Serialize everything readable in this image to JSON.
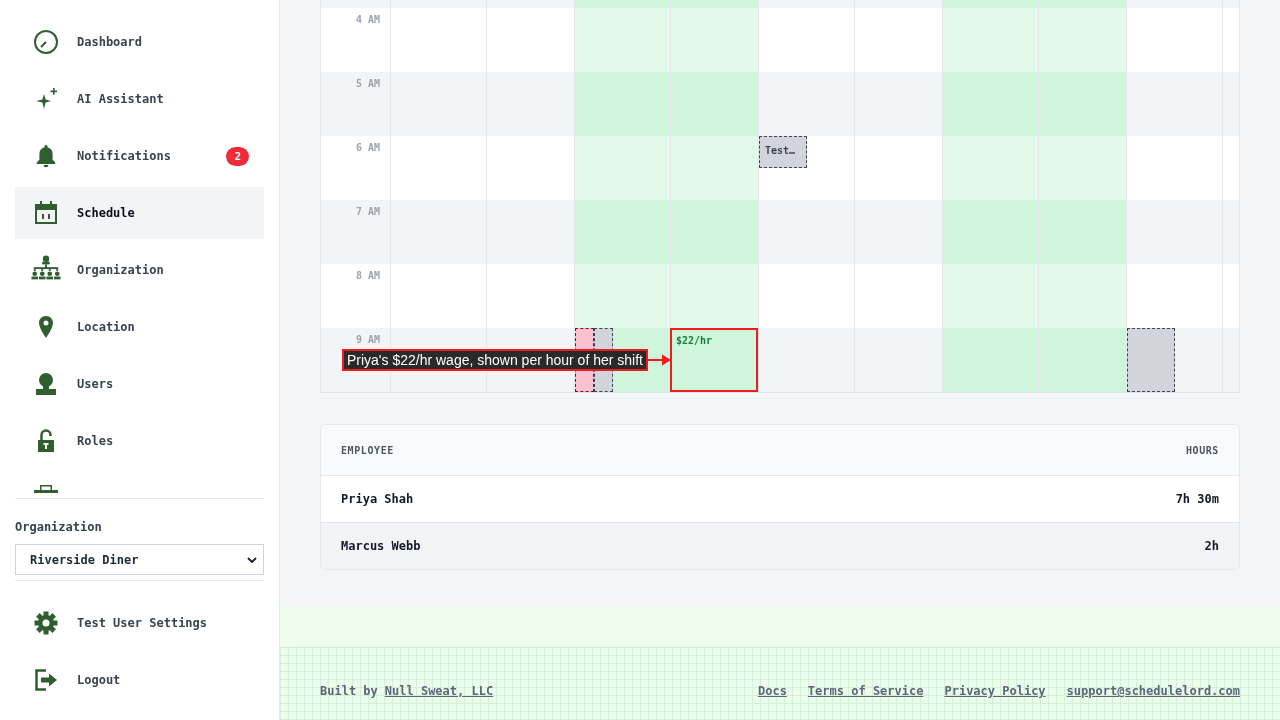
{
  "sidebar": {
    "nav": [
      {
        "label": "Dashboard",
        "selected": false
      },
      {
        "label": "AI Assistant",
        "selected": false
      },
      {
        "label": "Notifications",
        "selected": false,
        "badge": "2"
      },
      {
        "label": "Schedule",
        "selected": true
      },
      {
        "label": "Organization",
        "selected": false
      },
      {
        "label": "Location",
        "selected": false
      },
      {
        "label": "Users",
        "selected": false
      },
      {
        "label": "Roles",
        "selected": false
      }
    ],
    "organization": {
      "label": "Organization",
      "value": "Riverside Diner"
    },
    "account": [
      {
        "label": "Test User Settings"
      },
      {
        "label": "Logout"
      }
    ]
  },
  "calendar": {
    "rows": [
      {
        "cells": [
          {
            "highlighted": false
          },
          {
            "highlighted": false
          },
          {
            "highlighted": true
          },
          {
            "highlighted": true
          },
          {
            "highlighted": false
          },
          {
            "highlighted": false
          },
          {
            "highlighted": true
          },
          {
            "highlighted": true
          },
          {
            "highlighted": false
          },
          {
            "highlighted": false
          }
        ]
      },
      {
        "label": "4 AM",
        "cells": [
          {
            "highlighted": false
          },
          {
            "highlighted": false
          },
          {
            "highlighted": true
          },
          {
            "highlighted": true
          },
          {
            "highlighted": false
          },
          {
            "highlighted": false
          },
          {
            "highlighted": true
          },
          {
            "highlighted": true
          },
          {
            "highlighted": false
          },
          {
            "highlighted": false
          }
        ]
      },
      {
        "label": "5 AM",
        "cells": [
          {
            "highlighted": false
          },
          {
            "highlighted": false
          },
          {
            "highlighted": true
          },
          {
            "highlighted": true
          },
          {
            "highlighted": false
          },
          {
            "highlighted": false
          },
          {
            "highlighted": true
          },
          {
            "highlighted": true
          },
          {
            "highlighted": false
          },
          {
            "highlighted": false
          }
        ]
      },
      {
        "label": "6 AM",
        "cells": [
          {
            "highlighted": false
          },
          {
            "highlighted": false
          },
          {
            "highlighted": true
          },
          {
            "highlighted": true
          },
          {
            "highlighted": false,
            "events": [
              {
                "label": "Test…",
                "color": "#d1d5db",
                "half": true,
                "narrow": false
              }
            ]
          },
          {
            "highlighted": false
          },
          {
            "highlighted": true
          },
          {
            "highlighted": true
          },
          {
            "highlighted": false
          },
          {
            "highlighted": false
          }
        ]
      },
      {
        "label": "7 AM",
        "cells": [
          {
            "highlighted": false
          },
          {
            "highlighted": false
          },
          {
            "highlighted": true
          },
          {
            "highlighted": true
          },
          {
            "highlighted": false
          },
          {
            "highlighted": false
          },
          {
            "highlighted": true
          },
          {
            "highlighted": true
          },
          {
            "highlighted": false
          },
          {
            "highlighted": false
          }
        ]
      },
      {
        "label": "8 AM",
        "cells": [
          {
            "highlighted": false
          },
          {
            "highlighted": false
          },
          {
            "highlighted": true
          },
          {
            "highlighted": true
          },
          {
            "highlighted": false
          },
          {
            "highlighted": false
          },
          {
            "highlighted": true
          },
          {
            "highlighted": true
          },
          {
            "highlighted": false
          },
          {
            "highlighted": false
          }
        ]
      },
      {
        "label": "9 AM",
        "cells": [
          {
            "highlighted": false
          },
          {
            "highlighted": false
          },
          {
            "highlighted": true,
            "events": [
              {
                "color": "#fbc0d2",
                "half": false,
                "narrow": true
              },
              {
                "color": "#d1d5db",
                "half": false,
                "narrow": true
              }
            ]
          },
          {
            "highlighted": true,
            "wage": "$22/hr",
            "annotation": "Priya's $22/hr wage, shown per hour of her shift"
          },
          {
            "highlighted": false
          },
          {
            "highlighted": false
          },
          {
            "highlighted": true
          },
          {
            "highlighted": true
          },
          {
            "highlighted": false,
            "events": [
              {
                "color": "#d1d5db",
                "half": false,
                "narrow": false
              }
            ]
          },
          {
            "highlighted": false
          }
        ]
      }
    ]
  },
  "hours_table": {
    "columns": [
      "EMPLOYEE",
      "HOURS"
    ],
    "rows": [
      {
        "employee": "Priya Shah",
        "hours": "7h 30m"
      },
      {
        "employee": "Marcus Webb",
        "hours": "2h"
      }
    ]
  },
  "footer": {
    "credit": "Built by",
    "credit_link": "Null Sweat, LLC",
    "links": [
      "Docs",
      "Terms of Service",
      "Privacy Policy",
      "support@schedulelord.com"
    ]
  }
}
